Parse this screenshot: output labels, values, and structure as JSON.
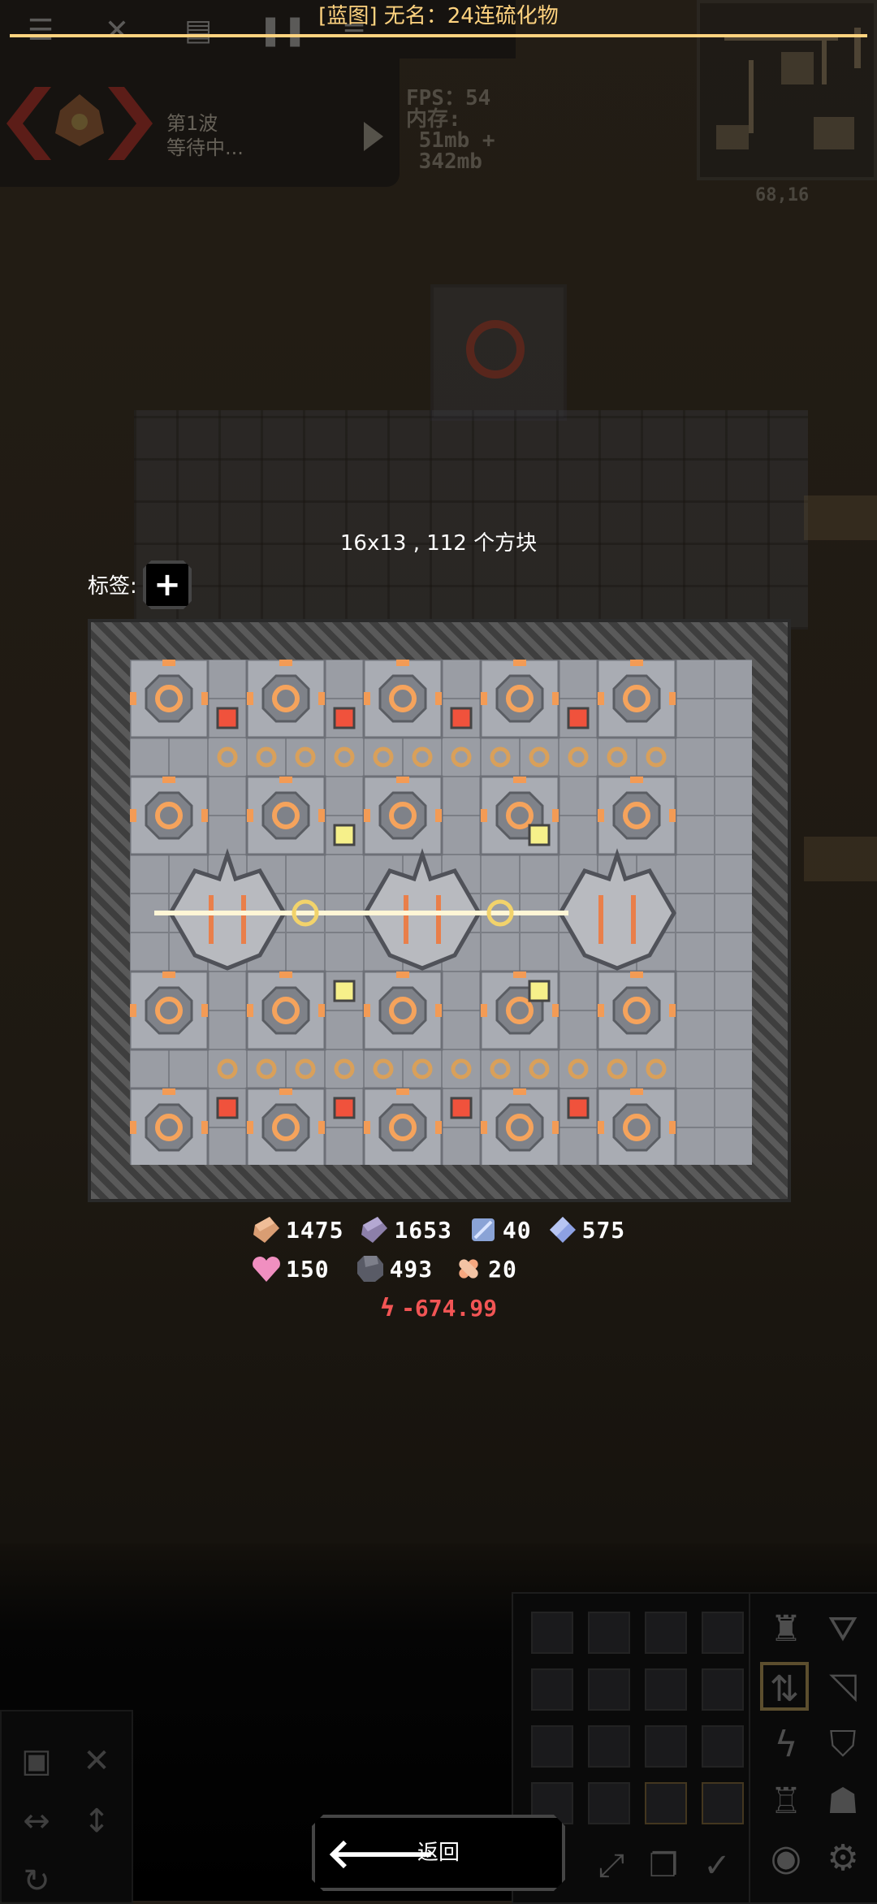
{
  "title": "[蓝图] 无名：24连硫化物",
  "hud": {
    "wave_label": "第1波",
    "wave_status": "等待中...",
    "stats": "FPS：54\n内存:\n 51mb +\n 342mb",
    "coords": "68,16"
  },
  "schematic": {
    "size_info": "16x13 , 112 个方块",
    "tags_label": "标签:",
    "add_tag_symbol": "+"
  },
  "requirements": [
    {
      "item": "copper",
      "icon": "copper-icon",
      "color": "#d99d73",
      "amount": "1475"
    },
    {
      "item": "lead",
      "icon": "lead-icon",
      "color": "#8c7fa9",
      "amount": "1653"
    },
    {
      "item": "metaglass",
      "icon": "metaglass-icon",
      "color": "#8aa3d6",
      "amount": "40"
    },
    {
      "item": "titanium",
      "icon": "titanium-icon",
      "color": "#8da1e3",
      "amount": "575"
    },
    {
      "item": "phase",
      "icon": "heart-crystal-icon",
      "color": "#f08fc0",
      "amount": "150"
    },
    {
      "item": "silicon",
      "icon": "silicon-icon",
      "color": "#595b66",
      "amount": "493"
    },
    {
      "item": "plastanium",
      "icon": "plastanium-icon",
      "color": "#f6a77f",
      "amount": "20"
    }
  ],
  "power": {
    "symbol": "ϟ",
    "value": "-674.99"
  },
  "back_button": {
    "label": "返回",
    "icon": "arrow-left-icon"
  },
  "colors": {
    "accent": "#ffd37f",
    "power": "#f25555"
  }
}
